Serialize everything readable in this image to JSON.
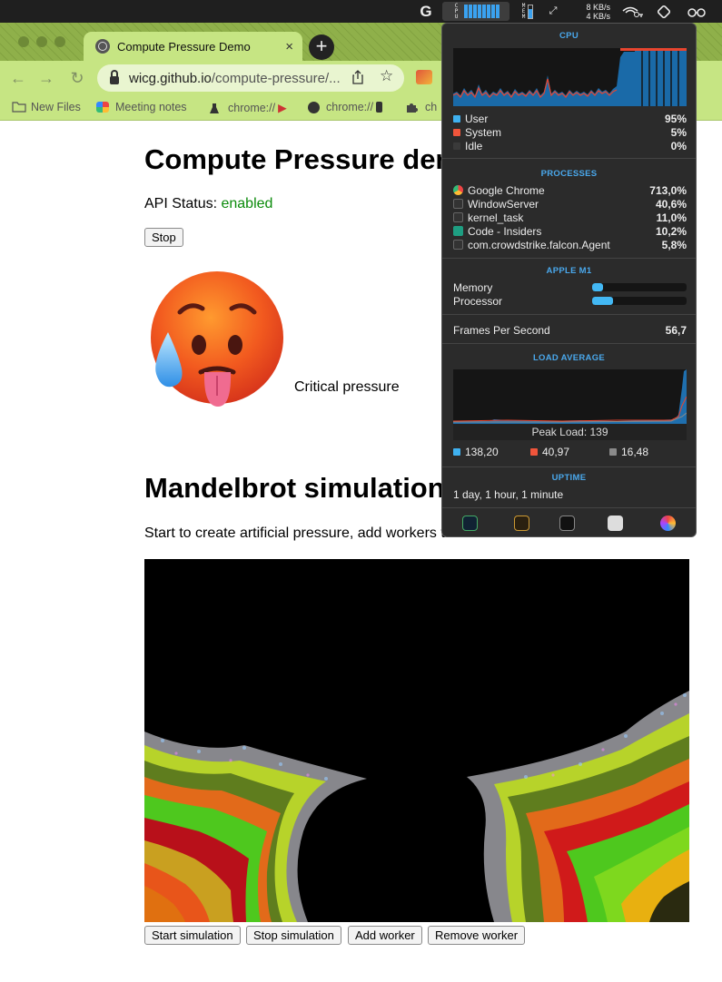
{
  "menubar": {
    "g_letter": "G",
    "cpu_label": "C\nP\nU",
    "mem_label": "M\nE\nM",
    "net_up": "8 KB/s",
    "net_down": "4 KB/s"
  },
  "browser": {
    "tab_title": "Compute Pressure Demo",
    "tab_close": "×",
    "new_tab": "+",
    "url_host": "wicg.github.io",
    "url_path": "/compute-pressure/...",
    "bookmarks": [
      {
        "label": "New Files",
        "icon": "folder-icon"
      },
      {
        "label": "Meeting notes",
        "icon": "colorful-icon"
      },
      {
        "label": "chrome://",
        "icon": "flask-icon"
      },
      {
        "label": "chrome://",
        "icon": "globe-icon"
      },
      {
        "label": "ch",
        "icon": "puzzle-icon"
      }
    ]
  },
  "page": {
    "title": "Compute Pressure demo",
    "api_status_label": "API Status: ",
    "api_status_value": "enabled",
    "stop_button": "Stop",
    "pressure_text": "Critical pressure",
    "mandelbrot_title": "Mandelbrot simulation",
    "mandelbrot_desc": "Start to create artificial pressure, add workers to increase further.",
    "buttons": {
      "start": "Start simulation",
      "stop": "Stop simulation",
      "add": "Add worker",
      "remove": "Remove worker"
    }
  },
  "stats": {
    "cpu_title": "CPU",
    "cpu": [
      {
        "label": "User",
        "value": "95%",
        "color": "#3fb1f0"
      },
      {
        "label": "System",
        "value": "5%",
        "color": "#f0553b"
      },
      {
        "label": "Idle",
        "value": "0%",
        "color": "#3a3a3a"
      }
    ],
    "processes_title": "PROCESSES",
    "processes": [
      {
        "name": "Google Chrome",
        "value": "713,0%",
        "icon": "chrome-icon"
      },
      {
        "name": "WindowServer",
        "value": "40,6%",
        "icon": "terminal-icon"
      },
      {
        "name": "kernel_task",
        "value": "11,0%",
        "icon": "terminal-icon"
      },
      {
        "name": "Code - Insiders",
        "value": "10,2%",
        "icon": "vscode-icon"
      },
      {
        "name": "com.crowdstrike.falcon.Agent",
        "value": "5,8%",
        "icon": "terminal-icon"
      }
    ],
    "apple_title": "APPLE M1",
    "memory_label": "Memory",
    "memory_level": 0.12,
    "processor_label": "Processor",
    "processor_level": 0.22,
    "fps_label": "Frames Per Second",
    "fps_value": "56,7",
    "load_title": "LOAD AVERAGE",
    "peak_load": "Peak Load: 139",
    "load": [
      {
        "value": "138,20",
        "color": "#3fb1f0"
      },
      {
        "value": "40,97",
        "color": "#f0553b"
      },
      {
        "value": "16,48",
        "color": "#8a8a8a"
      }
    ],
    "uptime_title": "UPTIME",
    "uptime_value": "1 day, 1 hour, 1 minute"
  }
}
